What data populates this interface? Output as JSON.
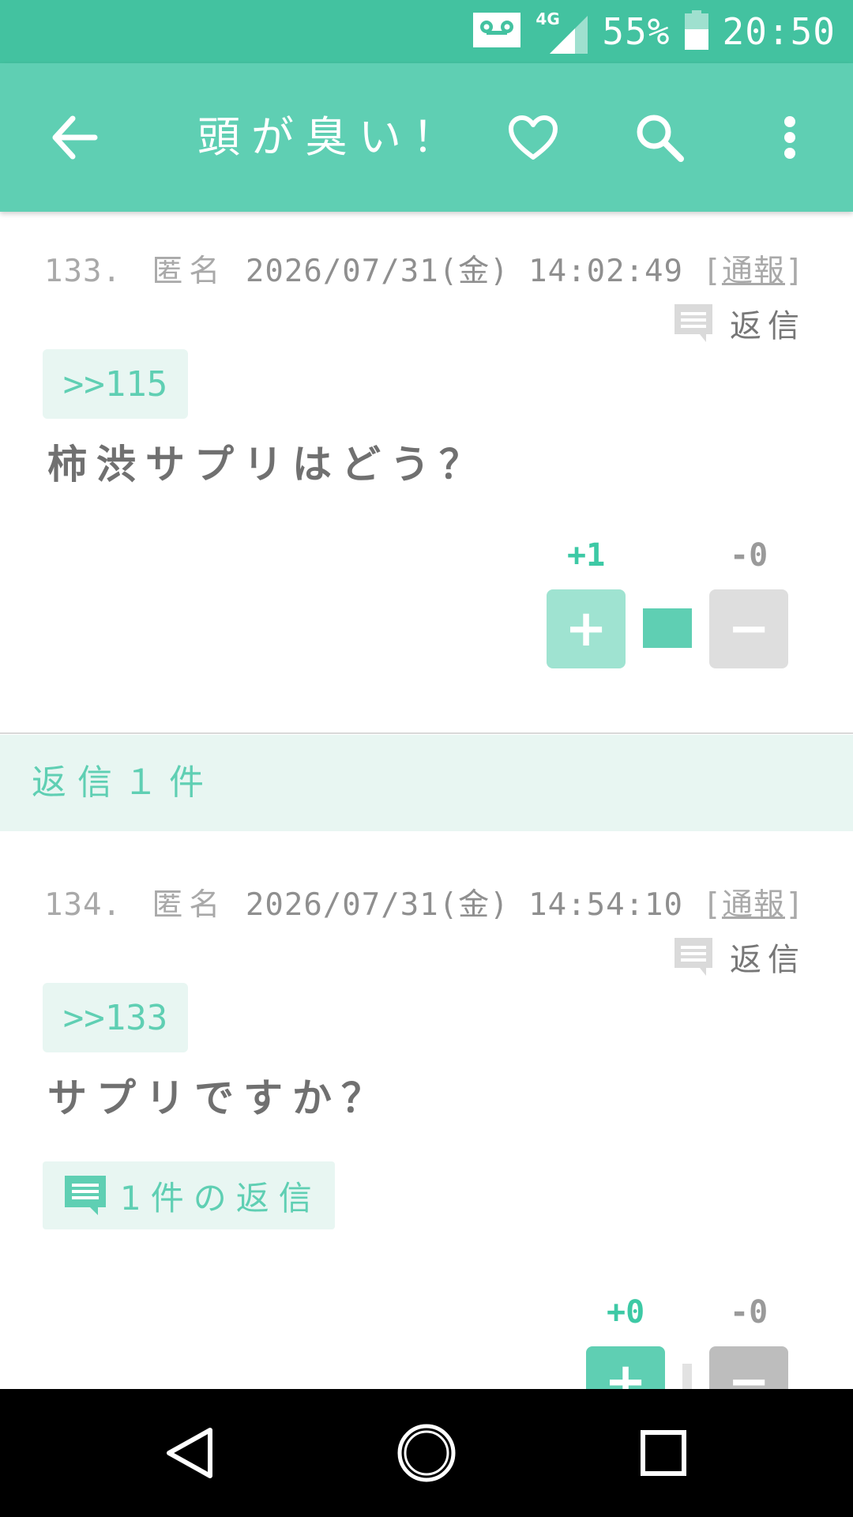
{
  "status_bar": {
    "network": "4G",
    "battery": "55%",
    "time": "20:50",
    "icons": [
      "voicemail-icon",
      "signal-icon",
      "battery-icon"
    ]
  },
  "app_bar": {
    "title": "頭が臭い！",
    "icons": [
      "back-arrow-icon",
      "heart-icon",
      "search-icon",
      "more-vert-icon"
    ]
  },
  "posts": [
    {
      "number": "133.",
      "author": "匿名",
      "datetime": "2026/07/31(金) 14:02:49",
      "report_open": "[",
      "report_label": "通報",
      "report_close": "]",
      "reply_label": "返信",
      "anchor": ">>115",
      "body": "柿渋サプリはどう？",
      "plus_count": "+1",
      "minus_count": "-0",
      "plus_label": "+",
      "minus_label": "−",
      "plus_ratio": 1.0
    },
    {
      "number": "134.",
      "author": "匿名",
      "datetime": "2026/07/31(金) 14:54:10",
      "report_open": "[",
      "report_label": "通報",
      "report_close": "]",
      "reply_label": "返信",
      "anchor": ">>133",
      "body": "サプリですか？",
      "replies_button": "1件の返信",
      "plus_count": "+0",
      "minus_count": "-0",
      "plus_label": "+",
      "minus_label": "−",
      "plus_ratio": 0.0
    }
  ],
  "reply_section": {
    "label": "返信１件"
  },
  "colors": {
    "status_bar": "#43c2a0",
    "app_bar": "#5fcfb3",
    "accent": "#5fcfb3",
    "light_accent": "#e8f6f2",
    "plus_count": "#3dc9a5",
    "minus_count": "#9a9a9a"
  },
  "nav_bar": {
    "icons": [
      "nav-back-icon",
      "nav-home-icon",
      "nav-recents-icon"
    ]
  }
}
